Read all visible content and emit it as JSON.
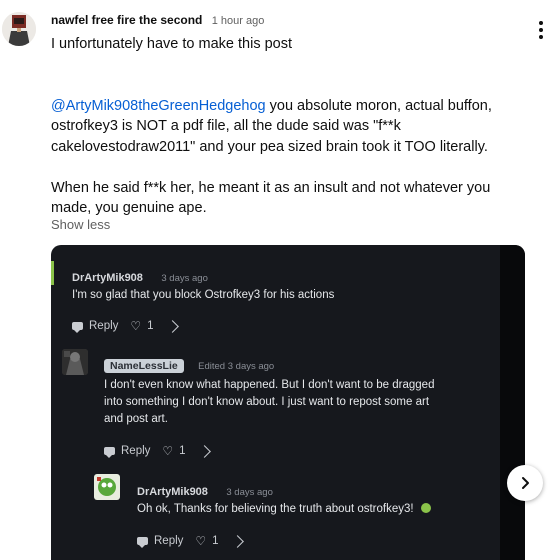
{
  "comment": {
    "author": "nawfel free fire the second",
    "time": "1 hour ago",
    "paragraphs": {
      "p1": "I unfortunately have to make this post",
      "p2_mention": "@ArtyMik908theGreenHedgehog",
      "p2_line1_rest": " you absolute moron, actual buffon,",
      "p2_line2": "ostrofkey3 is NOT a pdf file, all the dude said was \"f**k",
      "p2_line3": "cakelovestodraw2011\" and your pea sized brain took it TOO literally.",
      "p3_line1": "When he said f**k her, he meant it as an insult and not whatever you",
      "p3_line2": "made, you genuine ape."
    },
    "show_less": "Show less",
    "menu_icon": "more-vert-icon"
  },
  "screenshot": {
    "comments": [
      {
        "author": "DrArtyMik908",
        "time": "3 days ago",
        "lines": [
          "I'm so glad that you block Ostrofkey3 for his actions"
        ],
        "reply_label": "Reply",
        "likes": "1"
      },
      {
        "author": "NameLessLie",
        "time": "Edited 3 days ago",
        "lines": [
          "I don't even know what happened. But I don't want to be dragged",
          "into something I don't know about. I just want to repost some art",
          "and post art."
        ],
        "reply_label": "Reply",
        "likes": "1"
      },
      {
        "author": "DrArtyMik908",
        "time": "3 days ago",
        "lines": [
          "Oh ok, Thanks for believing the truth about ostrofkey3!"
        ],
        "reply_label": "Reply",
        "likes": "1"
      }
    ]
  },
  "nav": {
    "next_icon": "chevron-right-icon"
  }
}
